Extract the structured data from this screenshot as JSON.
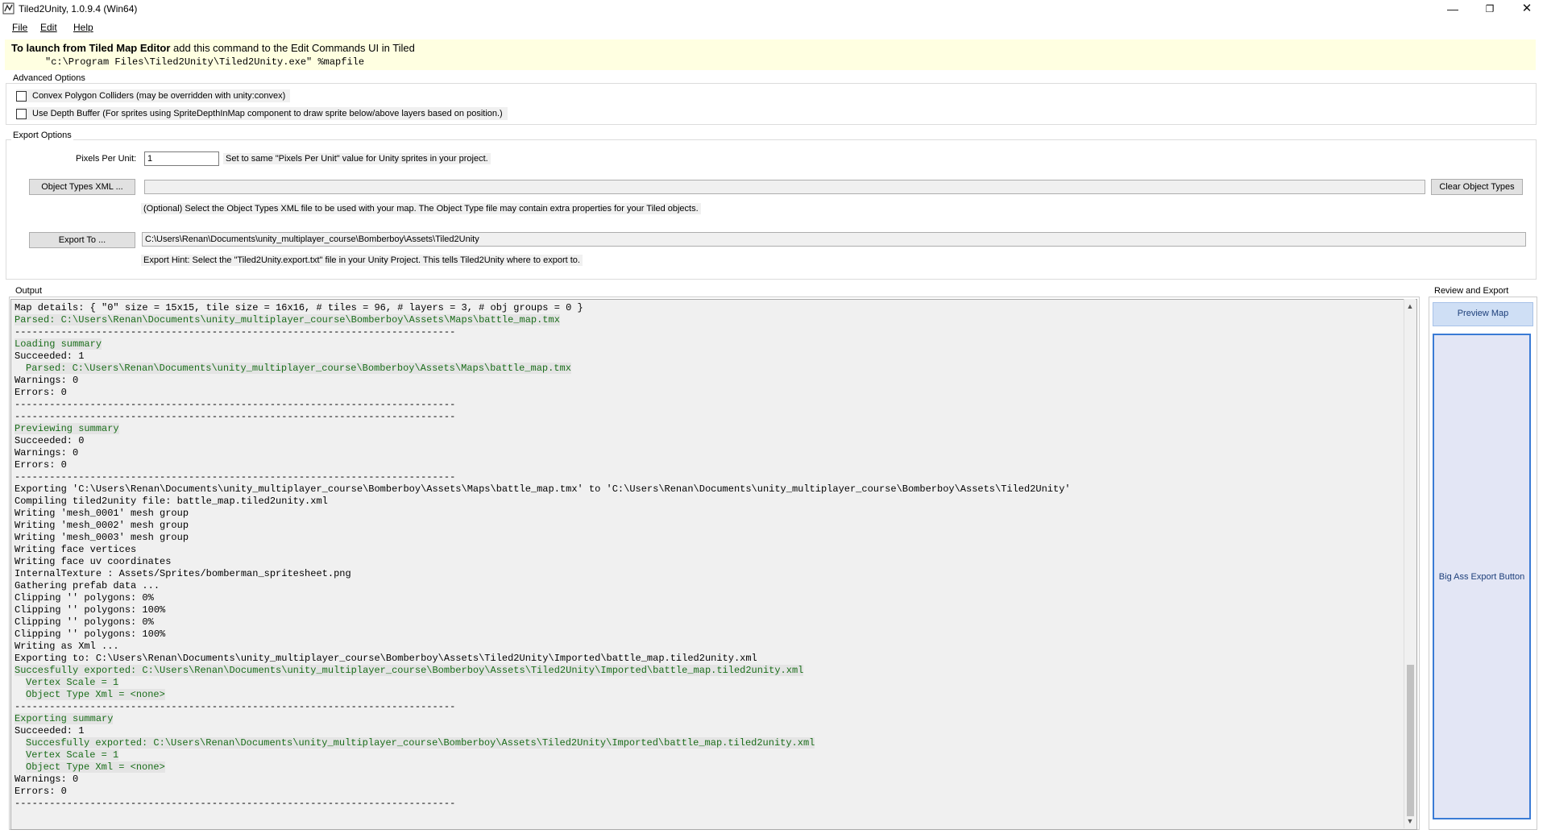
{
  "window": {
    "title": "Tiled2Unity, 1.0.9.4 (Win64)",
    "min_glyph": "—",
    "max_glyph": "❐",
    "close_glyph": "✕"
  },
  "menu": {
    "file": "File",
    "edit": "Edit",
    "help": "Help"
  },
  "banner": {
    "bold": "To launch from Tiled Map Editor",
    "rest": " add this command to the Edit Commands UI in Tiled",
    "command": "\"c:\\Program Files\\Tiled2Unity\\Tiled2Unity.exe\" %mapfile"
  },
  "advanced": {
    "title": "Advanced Options",
    "convex_label": "Convex Polygon Colliders (may be overridden with unity:convex)",
    "depth_label": "Use Depth Buffer (For sprites using SpriteDepthInMap component to draw sprite below/above layers based on position.)"
  },
  "export_options": {
    "title": "Export Options",
    "ppu_label": "Pixels Per Unit:",
    "ppu_value": "1",
    "ppu_hint": "Set to same \"Pixels Per Unit\" value for Unity sprites in your project.",
    "object_types_button": "Object Types XML ...",
    "object_types_value": "",
    "clear_object_types_button": "Clear Object Types",
    "object_types_hint": "(Optional) Select the Object Types XML file to be used with your map. The Object Type file may contain extra properties for your Tiled objects.",
    "export_to_button": "Export To ...",
    "export_to_value": "C:\\Users\\Renan\\Documents\\unity_multiplayer_course\\Bomberboy\\Assets\\Tiled2Unity",
    "export_hint": "Export Hint: Select the \"Tiled2Unity.export.txt\" file in your Unity Project. This tells Tiled2Unity where to export to."
  },
  "output": {
    "title": "Output",
    "lines": [
      {
        "t": "Map details: { \"0\" size = 15x15, tile size = 16x16, # tiles = 96, # layers = 3, # obj groups = 0 }",
        "g": false,
        "i": false
      },
      {
        "t": "Parsed: C:\\Users\\Renan\\Documents\\unity_multiplayer_course\\Bomberboy\\Assets\\Maps\\battle_map.tmx",
        "g": true,
        "i": false
      },
      {
        "t": "----------------------------------------------------------------------------",
        "g": false,
        "i": false
      },
      {
        "t": "Loading summary",
        "g": true,
        "i": false
      },
      {
        "t": "Succeeded: 1",
        "g": false,
        "i": false
      },
      {
        "t": "Parsed: C:\\Users\\Renan\\Documents\\unity_multiplayer_course\\Bomberboy\\Assets\\Maps\\battle_map.tmx",
        "g": true,
        "i": true
      },
      {
        "t": "Warnings: 0",
        "g": false,
        "i": false
      },
      {
        "t": "Errors: 0",
        "g": false,
        "i": false
      },
      {
        "t": "----------------------------------------------------------------------------",
        "g": false,
        "i": false
      },
      {
        "t": "----------------------------------------------------------------------------",
        "g": false,
        "i": false
      },
      {
        "t": "Previewing summary",
        "g": true,
        "i": false
      },
      {
        "t": "Succeeded: 0",
        "g": false,
        "i": false
      },
      {
        "t": "Warnings: 0",
        "g": false,
        "i": false
      },
      {
        "t": "Errors: 0",
        "g": false,
        "i": false
      },
      {
        "t": "----------------------------------------------------------------------------",
        "g": false,
        "i": false
      },
      {
        "t": "Exporting 'C:\\Users\\Renan\\Documents\\unity_multiplayer_course\\Bomberboy\\Assets\\Maps\\battle_map.tmx' to 'C:\\Users\\Renan\\Documents\\unity_multiplayer_course\\Bomberboy\\Assets\\Tiled2Unity'",
        "g": false,
        "i": false
      },
      {
        "t": "Compiling tiled2unity file: battle_map.tiled2unity.xml",
        "g": false,
        "i": false
      },
      {
        "t": "Writing 'mesh_0001' mesh group",
        "g": false,
        "i": false
      },
      {
        "t": "Writing 'mesh_0002' mesh group",
        "g": false,
        "i": false
      },
      {
        "t": "Writing 'mesh_0003' mesh group",
        "g": false,
        "i": false
      },
      {
        "t": "Writing face vertices",
        "g": false,
        "i": false
      },
      {
        "t": "Writing face uv coordinates",
        "g": false,
        "i": false
      },
      {
        "t": "InternalTexture : Assets/Sprites/bomberman_spritesheet.png",
        "g": false,
        "i": false
      },
      {
        "t": "Gathering prefab data ...",
        "g": false,
        "i": false
      },
      {
        "t": "Clipping '' polygons: 0%",
        "g": false,
        "i": false
      },
      {
        "t": "Clipping '' polygons: 100%",
        "g": false,
        "i": false
      },
      {
        "t": "Clipping '' polygons: 0%",
        "g": false,
        "i": false
      },
      {
        "t": "Clipping '' polygons: 100%",
        "g": false,
        "i": false
      },
      {
        "t": "Writing as Xml ...",
        "g": false,
        "i": false
      },
      {
        "t": "Exporting to: C:\\Users\\Renan\\Documents\\unity_multiplayer_course\\Bomberboy\\Assets\\Tiled2Unity\\Imported\\battle_map.tiled2unity.xml",
        "g": false,
        "i": false
      },
      {
        "t": "Succesfully exported: C:\\Users\\Renan\\Documents\\unity_multiplayer_course\\Bomberboy\\Assets\\Tiled2Unity\\Imported\\battle_map.tiled2unity.xml",
        "g": true,
        "i": false
      },
      {
        "t": "Vertex Scale = 1",
        "g": true,
        "i": true
      },
      {
        "t": "Object Type Xml = <none>",
        "g": true,
        "i": true
      },
      {
        "t": "----------------------------------------------------------------------------",
        "g": false,
        "i": false
      },
      {
        "t": "Exporting summary",
        "g": true,
        "i": false
      },
      {
        "t": "Succeeded: 1",
        "g": false,
        "i": false
      },
      {
        "t": "Succesfully exported: C:\\Users\\Renan\\Documents\\unity_multiplayer_course\\Bomberboy\\Assets\\Tiled2Unity\\Imported\\battle_map.tiled2unity.xml",
        "g": true,
        "i": true
      },
      {
        "t": "Vertex Scale = 1",
        "g": true,
        "i": true
      },
      {
        "t": "Object Type Xml = <none>",
        "g": true,
        "i": true
      },
      {
        "t": "Warnings: 0",
        "g": false,
        "i": false
      },
      {
        "t": "Errors: 0",
        "g": false,
        "i": false
      },
      {
        "t": "----------------------------------------------------------------------------",
        "g": false,
        "i": false
      }
    ]
  },
  "review": {
    "title": "Review and Export",
    "preview_button": "Preview Map",
    "big_export_button": "Big Ass Export Button"
  },
  "colors": {
    "banner_bg": "#ffffe1",
    "log_green": "#1a6d1a",
    "big_button_border": "#3a7bd5"
  }
}
